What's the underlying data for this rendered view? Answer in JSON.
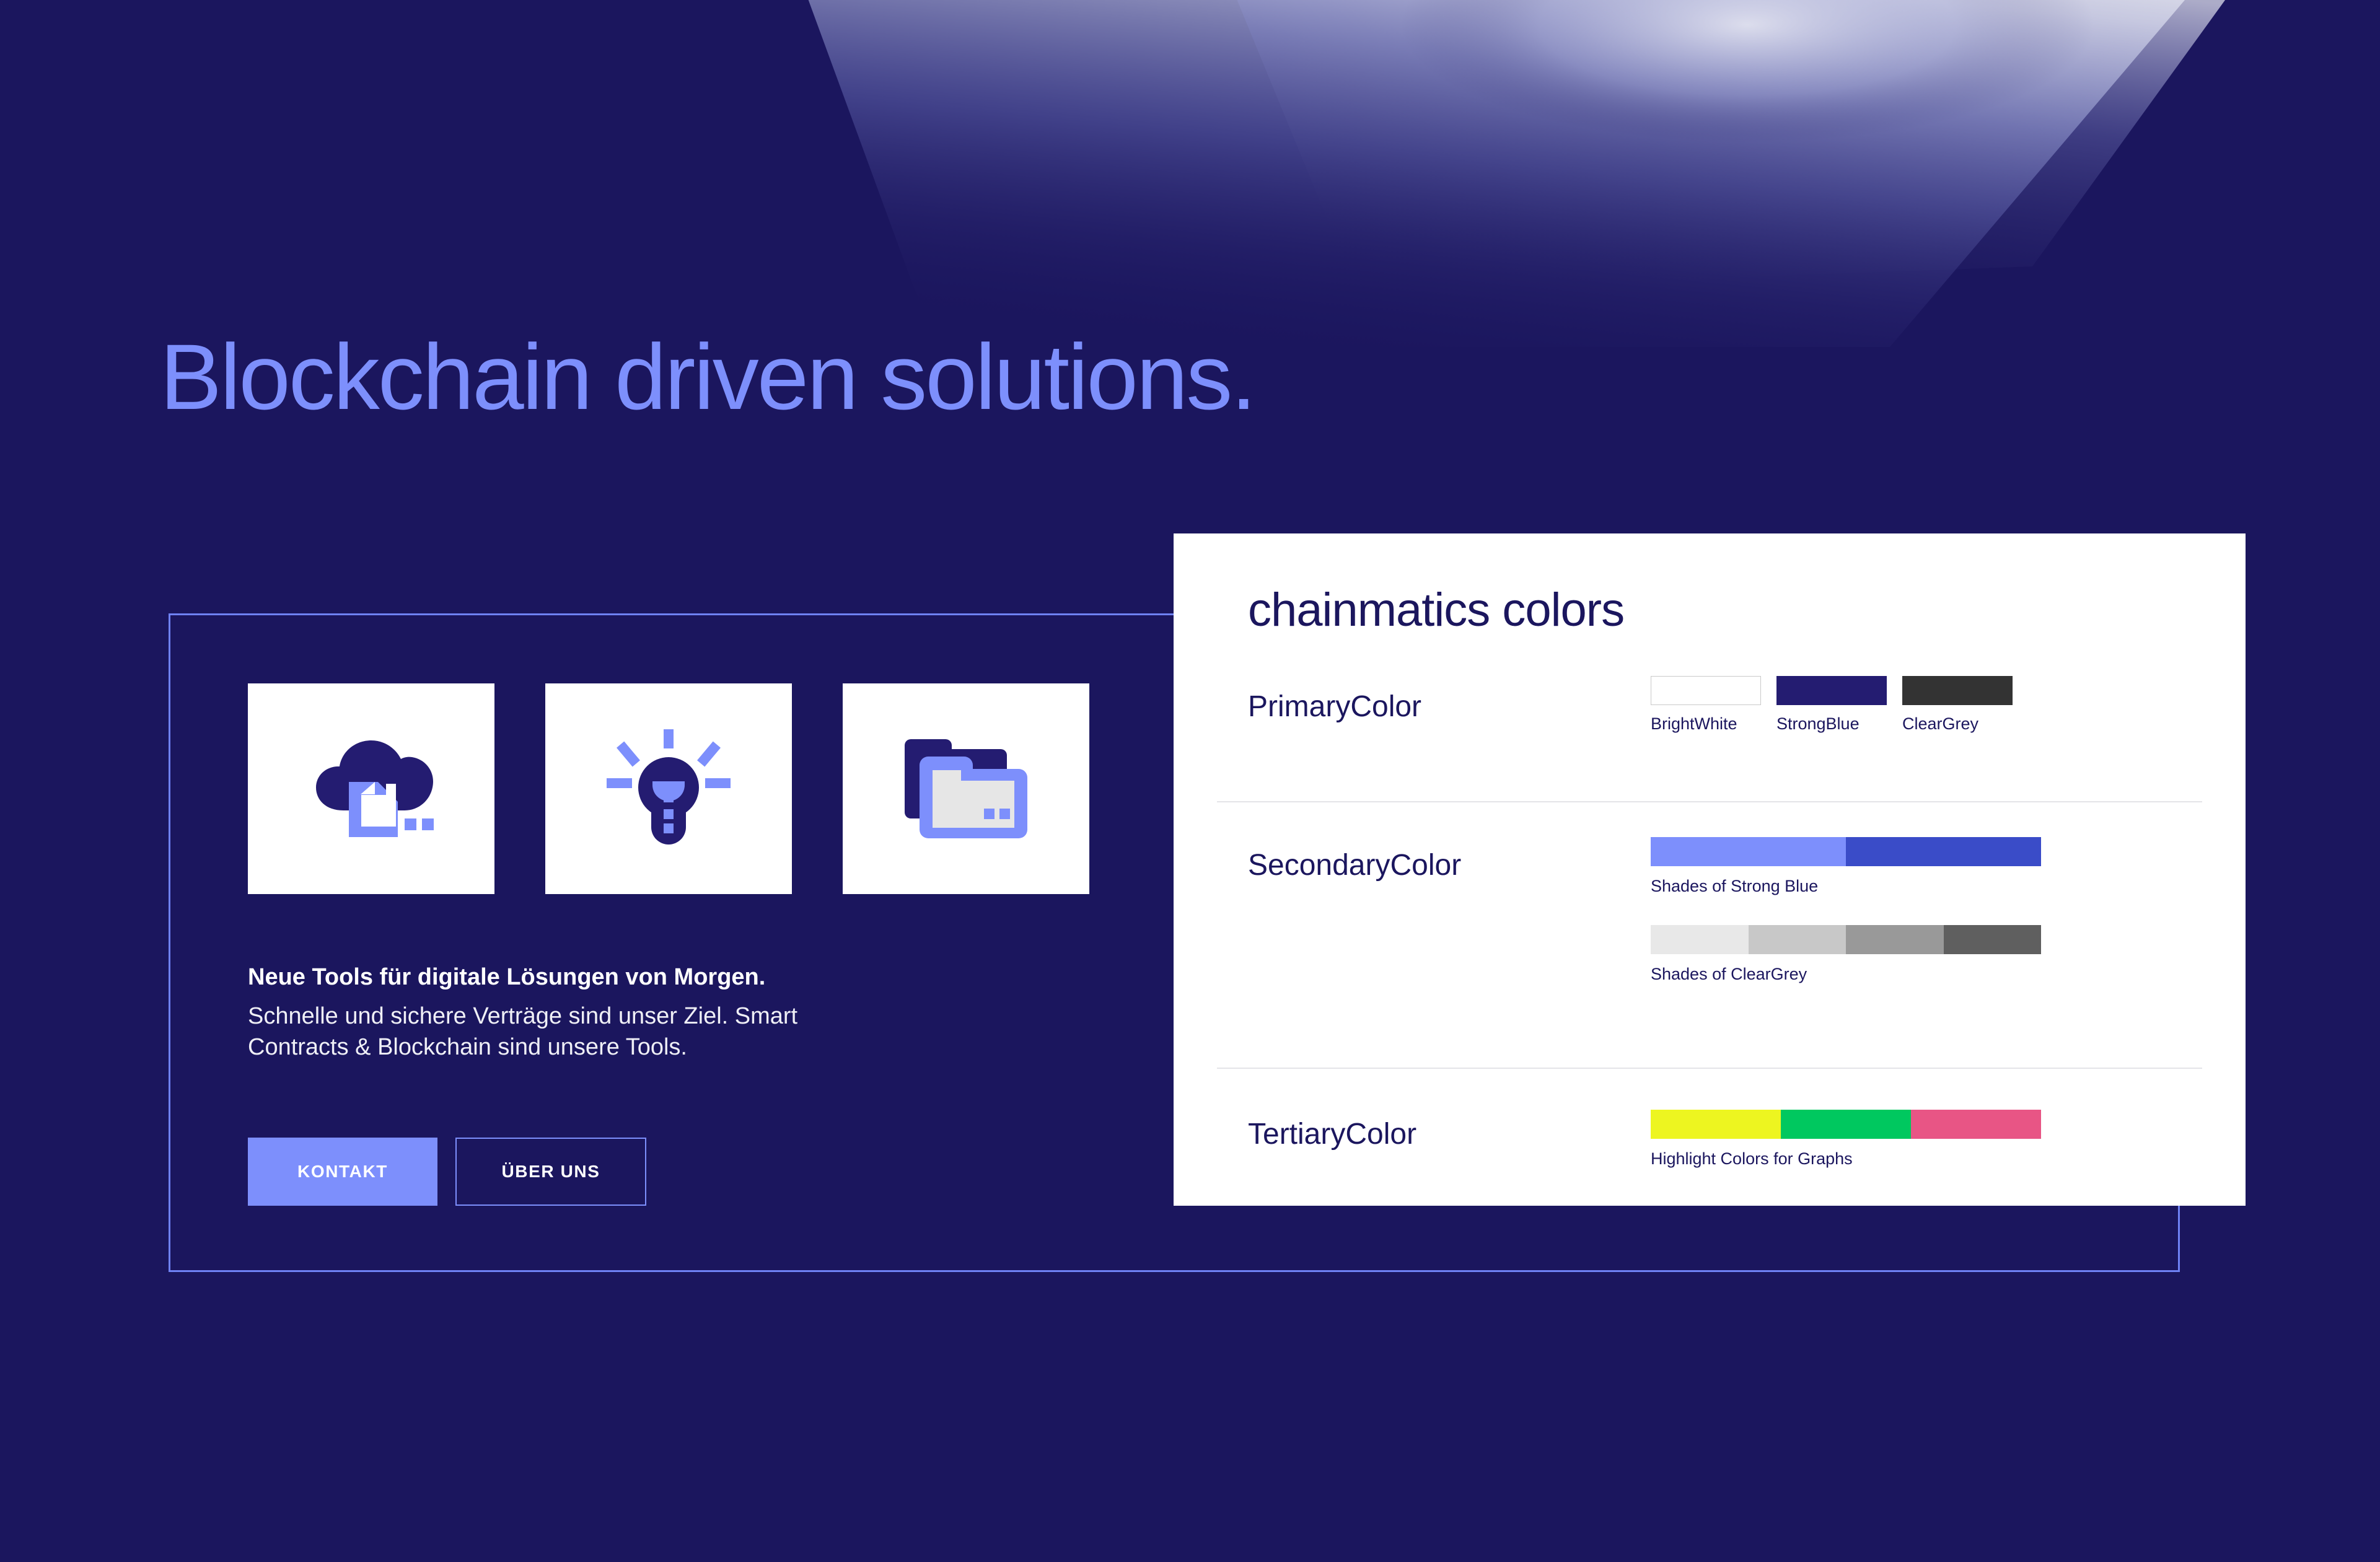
{
  "page": {
    "background_color": "#1B165E",
    "accent_color": "#7D8FFC"
  },
  "hero": {
    "headline": "Blockchain driven solutions."
  },
  "feature_cards": [
    {
      "icon": "cloud-document-icon",
      "card_background": "#FFFFFF"
    },
    {
      "icon": "lightbulb-idea-icon",
      "card_background": "#FFFFFF"
    },
    {
      "icon": "folders-stack-icon",
      "card_background": "#FFFFFF"
    }
  ],
  "copy": {
    "heading": "Neue Tools für digitale Lösungen von Morgen.",
    "body_line_1": "Schnelle und sichere Verträge sind unser Ziel. Smart",
    "body_line_2": "Contracts & Blockchain sind unsere Tools."
  },
  "buttons": {
    "primary_label": "KONTAKT",
    "secondary_label": "ÜBER UNS"
  },
  "color_panel": {
    "title": "chainmatics colors",
    "rows": [
      {
        "label": "PrimaryColor",
        "swatches": [
          {
            "caption": "BrightWhite",
            "hex": "#FFFFFF",
            "has_border": true
          },
          {
            "caption": "StrongBlue",
            "hex": "#241C71",
            "has_border": false
          },
          {
            "caption": "ClearGrey",
            "hex": "#333333",
            "has_border": false
          }
        ]
      },
      {
        "label": "SecondaryColor",
        "bars": [
          {
            "caption": "Shades of Strong Blue",
            "segments": [
              "#7D8FFC",
              "#3A4CC8"
            ]
          },
          {
            "caption": "Shades of ClearGrey",
            "segments": [
              "#E8E8E8",
              "#C8C8C8",
              "#999999",
              "#5F5F5F"
            ]
          }
        ]
      },
      {
        "label": "TertiaryColor",
        "bars": [
          {
            "caption": "Highlight Colors for Graphs",
            "segments": [
              "#EDF520",
              "#00C85F",
              "#E85585"
            ]
          }
        ]
      }
    ]
  }
}
